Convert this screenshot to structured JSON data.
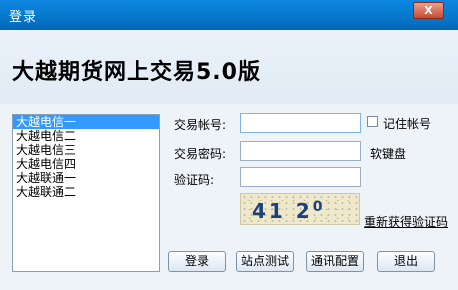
{
  "window": {
    "title": "登录",
    "close_label": "X"
  },
  "heading": "大越期货网上交易5.0版",
  "servers": [
    "大越电信一",
    "大越电信二",
    "大越电信三",
    "大越电信四",
    "大越联通一",
    "大越联通二"
  ],
  "form": {
    "account_label": "交易帐号:",
    "remember_label": "记住帐号",
    "password_label": "交易密码:",
    "soft_keyboard_label": "软键盘",
    "captcha_label": "验证码:",
    "captcha_text": "41 2",
    "captcha_sup": "0",
    "refresh_captcha_label": "重新获得验证码"
  },
  "buttons": {
    "login": "登录",
    "test": "站点测试",
    "config": "通讯配置",
    "exit": "退出"
  }
}
